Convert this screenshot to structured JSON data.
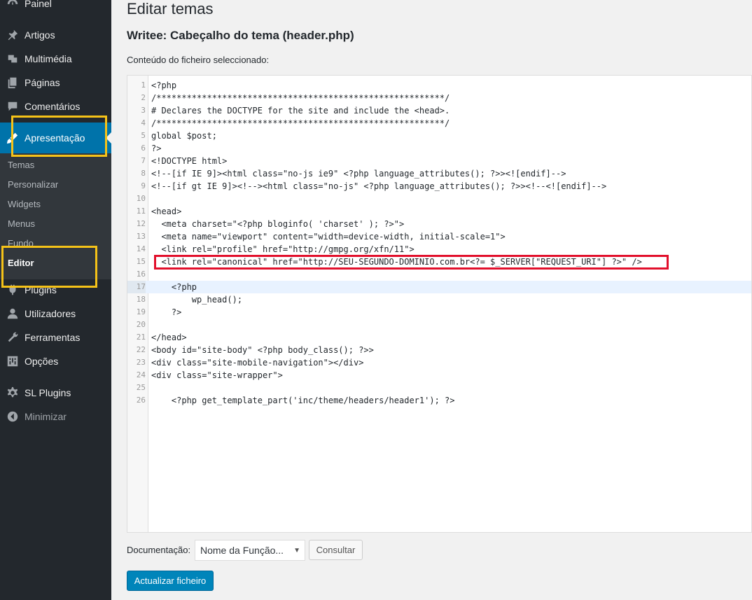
{
  "sidebar": {
    "items": [
      {
        "label": "Painel",
        "icon": "dashboard-icon"
      },
      {
        "label": "Artigos",
        "icon": "pin-icon"
      },
      {
        "label": "Multimédia",
        "icon": "media-icon"
      },
      {
        "label": "Páginas",
        "icon": "pages-icon"
      },
      {
        "label": "Comentários",
        "icon": "comments-icon"
      },
      {
        "label": "Apresentação",
        "icon": "appearance-icon"
      },
      {
        "label": "Plugins",
        "icon": "plugins-icon"
      },
      {
        "label": "Utilizadores",
        "icon": "users-icon"
      },
      {
        "label": "Ferramentas",
        "icon": "tools-icon"
      },
      {
        "label": "Opções",
        "icon": "settings-icon"
      },
      {
        "label": "SL Plugins",
        "icon": "gear-icon"
      },
      {
        "label": "Minimizar",
        "icon": "collapse-icon"
      }
    ],
    "submenu": [
      "Temas",
      "Personalizar",
      "Widgets",
      "Menus",
      "Fundo",
      "Editor"
    ]
  },
  "main": {
    "page_title": "Editar temas",
    "file_title": "Writee: Cabeçalho do tema (header.php)",
    "file_label": "Conteúdo do ficheiro seleccionado:",
    "code": [
      "<?php",
      "/*********************************************************/",
      "# Declares the DOCTYPE for the site and include the <head>.",
      "/*********************************************************/",
      "global $post;",
      "?>",
      "<!DOCTYPE html>",
      "<!--[if IE 9]><html class=\"no-js ie9\" <?php language_attributes(); ?>><![endif]-->",
      "<!--[if gt IE 9]><!--><html class=\"no-js\" <?php language_attributes(); ?>><!--<![endif]-->",
      "",
      "<head>",
      "  <meta charset=\"<?php bloginfo( 'charset' ); ?>\">",
      "  <meta name=\"viewport\" content=\"width=device-width, initial-scale=1\">",
      "  <link rel=\"profile\" href=\"http://gmpg.org/xfn/11\">",
      "  <link rel=\"canonical\" href=\"http://SEU-SEGUNDO-DOMINIO.com.br<?= $_SERVER[\"REQUEST_URI\"] ?>\" />",
      "",
      "    <?php",
      "        wp_head();",
      "    ?>",
      "",
      "</head>",
      "<body id=\"site-body\" <?php body_class(); ?>>",
      "<div class=\"site-mobile-navigation\"></div>",
      "<div class=\"site-wrapper\">",
      "",
      "    <?php get_template_part('inc/theme/headers/header1'); ?>"
    ],
    "documentation_label": "Documentação:",
    "function_select": "Nome da Função...",
    "consult_button": "Consultar",
    "update_button": "Actualizar ficheiro"
  },
  "colors": {
    "sidebar_bg": "#23282d",
    "submenu_bg": "#32373c",
    "active_bg": "#0073aa",
    "button_primary": "#0085ba",
    "highlight_yellow": "#f5c218",
    "highlight_red": "#e2102c"
  }
}
